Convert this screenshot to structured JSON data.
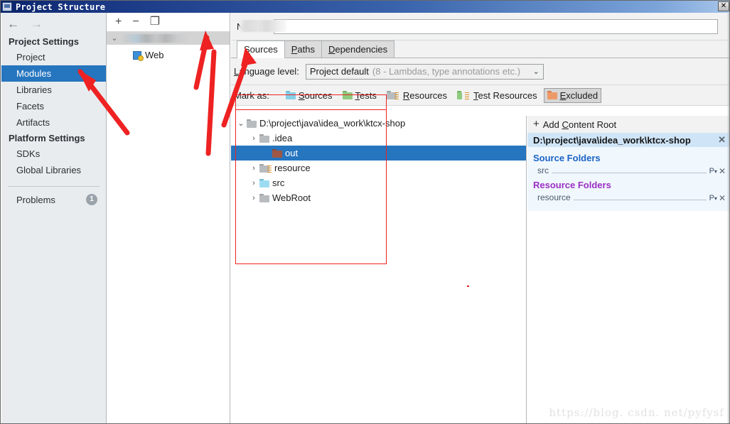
{
  "window": {
    "title": "Project Structure",
    "close_label": "✕"
  },
  "sidebar": {
    "nav": {
      "back": "←",
      "forward": "→"
    },
    "groups": [
      {
        "title": "Project Settings",
        "items": [
          {
            "label": "Project",
            "selected": false
          },
          {
            "label": "Modules",
            "selected": true
          },
          {
            "label": "Libraries",
            "selected": false
          },
          {
            "label": "Facets",
            "selected": false
          },
          {
            "label": "Artifacts",
            "selected": false
          }
        ]
      },
      {
        "title": "Platform Settings",
        "items": [
          {
            "label": "SDKs",
            "selected": false
          },
          {
            "label": "Global Libraries",
            "selected": false
          }
        ]
      }
    ],
    "problems": {
      "label": "Problems",
      "count": "1"
    }
  },
  "modules_panel": {
    "toolbar": {
      "add": "+",
      "remove": "−",
      "copy": "❐"
    },
    "module_row": {
      "twisty": "⌄",
      "name_redacted": ""
    },
    "facet": {
      "label": "Web"
    }
  },
  "name_row": {
    "label_pre": "Na",
    "label_mnemonic": "m",
    "label_post": "e:",
    "value": "",
    "placeholder": ""
  },
  "tabs": [
    {
      "label_pre": "",
      "mnemonic": "S",
      "label_post": "ources",
      "active": true
    },
    {
      "label_pre": "",
      "mnemonic": "P",
      "label_post": "aths",
      "active": false
    },
    {
      "label_pre": "",
      "mnemonic": "D",
      "label_post": "ependencies",
      "active": false
    }
  ],
  "language_level": {
    "label_pre": "L",
    "label_post": "anguage level:",
    "value": "Project default",
    "hint": "(8 - Lambdas, type annotations etc.)",
    "caret": "⌄"
  },
  "mark_as": {
    "label": "Mark as:",
    "options": [
      {
        "pre": "",
        "mnemonic": "S",
        "post": "ources",
        "color": "#86cfe8",
        "tab_color": "#6cb9d4",
        "lines": false,
        "pressed": false
      },
      {
        "pre": "",
        "mnemonic": "T",
        "post": "ests",
        "color": "#8ecb7f",
        "tab_color": "#74b165",
        "lines": false,
        "pressed": false
      },
      {
        "pre": "",
        "mnemonic": "R",
        "post": "esources",
        "color": "#b9bcbf",
        "tab_color": "#9ea2a5",
        "lines": true,
        "pressed": false
      },
      {
        "pre": "",
        "mnemonic": "T",
        "post": "est Resources",
        "color": "#8ecb7f",
        "tab_color": "#74b165",
        "lines": true,
        "pressed": false
      },
      {
        "pre": "",
        "mnemonic": "E",
        "post": "xcluded",
        "color": "#ee9a68",
        "tab_color": "#d47f4e",
        "lines": false,
        "pressed": true
      }
    ]
  },
  "tree": {
    "rows": [
      {
        "twisty": "⌄",
        "label": "D:\\project\\java\\idea_work\\ktcx-shop",
        "indent": 6,
        "icon": "folder-gray",
        "selected": false
      },
      {
        "twisty": "›",
        "label": ".idea",
        "indent": 24,
        "icon": "folder-gray",
        "selected": false
      },
      {
        "twisty": "",
        "label": "out",
        "indent": 42,
        "icon": "folder-excluded",
        "selected": true
      },
      {
        "twisty": "›",
        "label": "resource",
        "indent": 24,
        "icon": "folder-resource",
        "selected": false
      },
      {
        "twisty": "›",
        "label": "src",
        "indent": 24,
        "icon": "folder-source",
        "selected": false
      },
      {
        "twisty": "›",
        "label": "WebRoot",
        "indent": 24,
        "icon": "folder-gray",
        "selected": false
      }
    ]
  },
  "detail": {
    "add_content_root": {
      "plus": "+",
      "pre": "Add ",
      "mnemonic": "C",
      "post": "ontent Root"
    },
    "content_root": {
      "path": "D:\\project\\java\\idea_work\\ktcx-shop",
      "close": "✕"
    },
    "source_folders": {
      "title": "Source Folders",
      "entries": [
        {
          "name": "src",
          "props": "P",
          "close": "✕"
        }
      ]
    },
    "resource_folders": {
      "title": "Resource Folders",
      "entries": [
        {
          "name": "resource",
          "props": "P",
          "close": "✕"
        }
      ]
    }
  },
  "annotations": {
    "watermark": "https://blog. csdn. net/pyfysf",
    "accent_red": "#ee2222",
    "highlight_blue": "#2675bf"
  }
}
